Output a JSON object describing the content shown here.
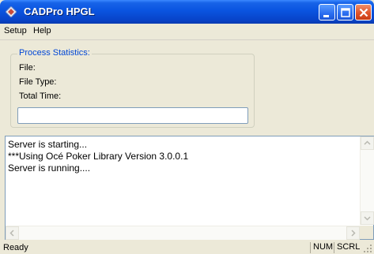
{
  "window": {
    "title": "CADPro HPGL",
    "colors": {
      "titlebar": "#0a54e0",
      "close_button": "#e0542a",
      "legend_text": "#0046d5"
    }
  },
  "menu": {
    "items": [
      "Setup",
      "Help"
    ]
  },
  "stats": {
    "legend": "Process Statistics:",
    "file_label": "File:",
    "filetype_label": "File Type:",
    "totaltime_label": "Total Time:",
    "progress_value": ""
  },
  "log": {
    "lines": [
      "Server is starting...",
      "***Using Océ Poker Library Version 3.0.0.1",
      "Server is running...."
    ]
  },
  "status": {
    "text": "Ready",
    "num": "NUM",
    "scrl": "SCRL"
  }
}
